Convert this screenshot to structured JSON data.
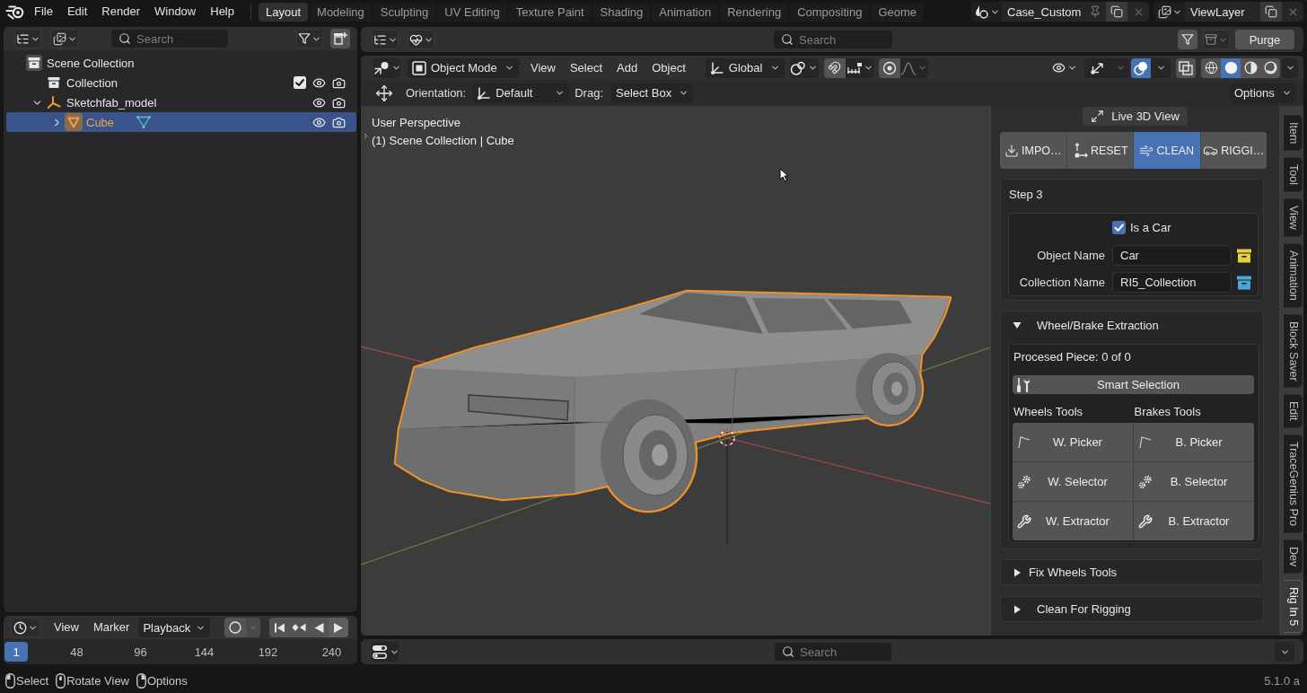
{
  "top_bar": {
    "menus": [
      "File",
      "Edit",
      "Render",
      "Window",
      "Help"
    ],
    "workspaces": [
      {
        "label": "Layout",
        "selected": true
      },
      {
        "label": "Modeling",
        "selected": false
      },
      {
        "label": "Sculpting",
        "selected": false
      },
      {
        "label": "UV Editing",
        "selected": false
      },
      {
        "label": "Texture Paint",
        "selected": false
      },
      {
        "label": "Shading",
        "selected": false
      },
      {
        "label": "Animation",
        "selected": false
      },
      {
        "label": "Rendering",
        "selected": false
      },
      {
        "label": "Compositing",
        "selected": false
      },
      {
        "label": "Geome",
        "selected": false
      }
    ],
    "scene": "Case_Custom",
    "view_layer": "ViewLayer"
  },
  "outliner": {
    "search": {
      "placeholder": "Search"
    },
    "tree": [
      {
        "label": "Scene Collection",
        "kind": "scene",
        "selected": false,
        "children": [
          {
            "label": "Collection",
            "kind": "collection",
            "selected": false,
            "checked": true
          },
          {
            "label": "Sketchfab_model",
            "kind": "empty",
            "selected": false,
            "expanded": true,
            "children": [
              {
                "label": "Cube",
                "kind": "mesh",
                "selected": true,
                "expanded": false
              }
            ]
          }
        ]
      }
    ]
  },
  "timeline": {
    "menus": [
      "View",
      "Marker"
    ],
    "playback": "Playback",
    "current_frame": "1",
    "frames": [
      "48",
      "96",
      "144",
      "192",
      "240"
    ]
  },
  "asset_header": {
    "search": {
      "placeholder": "Search"
    },
    "purge": "Purge"
  },
  "viewport": {
    "mode": "Object Mode",
    "menus": [
      "View",
      "Select",
      "Add",
      "Object"
    ],
    "transform_orientation": "Global",
    "overlays_on": true,
    "xray_on": false,
    "shading": [
      {
        "kind": "wireframe",
        "selected": false
      },
      {
        "kind": "solid",
        "selected": true
      },
      {
        "kind": "material",
        "selected": false
      },
      {
        "kind": "rendered",
        "selected": false
      }
    ],
    "tool_settings": {
      "orientation_label": "Orientation:",
      "orientation": "Default",
      "drag_label": "Drag:",
      "drag": "Select Box",
      "options": "Options"
    },
    "info": [
      "User Perspective",
      "(1) Scene Collection | Cube"
    ]
  },
  "sidebar": {
    "live_view": "Live 3D View",
    "tabs": [
      {
        "label": "IMPO…",
        "kind": "import",
        "selected": false
      },
      {
        "label": "RESET",
        "kind": "reset",
        "selected": false
      },
      {
        "label": "CLEAN",
        "kind": "clean",
        "selected": true
      },
      {
        "label": "RIGGI…",
        "kind": "rig",
        "selected": false
      }
    ],
    "step": "Step 3",
    "is_car": {
      "label": "Is a Car",
      "checked": true
    },
    "fields": [
      {
        "label": "Object Name",
        "value": "Car",
        "color": "#e6cf3c"
      },
      {
        "label": "Collection Name",
        "value": "RI5_Collection",
        "color": "#4ea5dc"
      }
    ],
    "panels": [
      {
        "title": "Wheel/Brake Extraction",
        "expanded": true,
        "progress": "Procesed Piece: 0 of 0",
        "smart_selection": "Smart Selection",
        "columns": [
          "Wheels Tools",
          "Brakes Tools"
        ],
        "tools": [
          {
            "label": "W. Picker",
            "kind": "picker"
          },
          {
            "label": "B. Picker",
            "kind": "picker"
          },
          {
            "label": "W. Selector",
            "kind": "selector"
          },
          {
            "label": "B. Selector",
            "kind": "selector"
          },
          {
            "label": "W. Extractor",
            "kind": "extractor"
          },
          {
            "label": "B. Extractor",
            "kind": "extractor"
          }
        ]
      },
      {
        "title": "Fix Wheels Tools",
        "expanded": false
      },
      {
        "title": "Clean For Rigging",
        "expanded": false
      }
    ],
    "side_tabs": [
      {
        "label": "Item",
        "selected": false
      },
      {
        "label": "Tool",
        "selected": false
      },
      {
        "label": "View",
        "selected": false
      },
      {
        "label": "Animation",
        "selected": false
      },
      {
        "label": "Block Saver",
        "selected": false
      },
      {
        "label": "Edit",
        "selected": false
      },
      {
        "label": "TraceGenius Pro",
        "selected": false
      },
      {
        "label": "Dev",
        "selected": false
      },
      {
        "label": "Rig In 5",
        "selected": true
      }
    ]
  },
  "bottom_header": {
    "search": {
      "placeholder": "Search"
    }
  },
  "status_bar": {
    "hints": [
      "Select",
      "Rotate View",
      "Options"
    ],
    "version": "5.1.0 a"
  }
}
